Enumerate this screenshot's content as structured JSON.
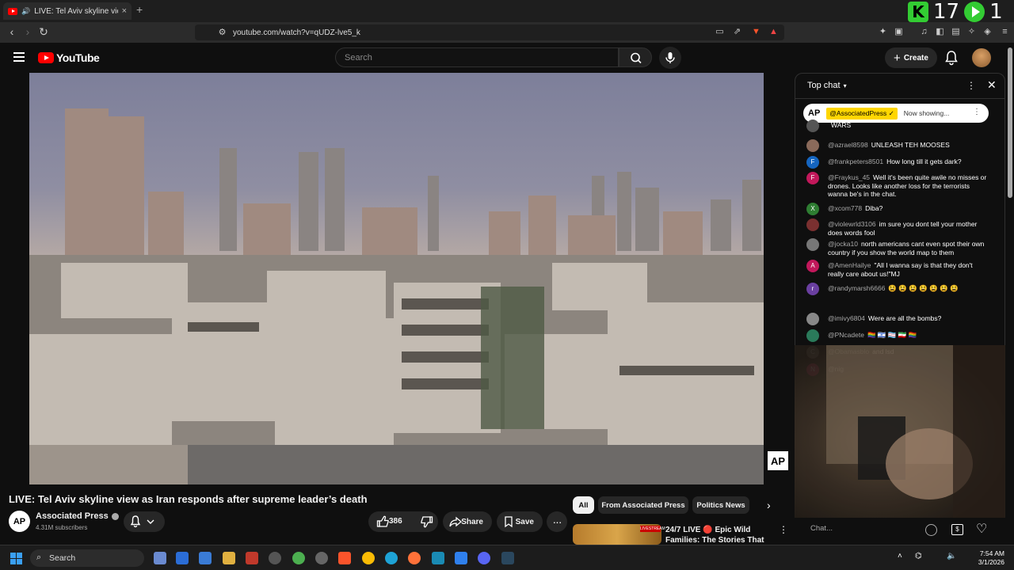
{
  "browser": {
    "tab_title": "LIVE: Tel Aviv skyline view as I",
    "tab_close": "×",
    "new_tab": "+",
    "url": "youtube.com/watch?v=qUDZ-lve5_k",
    "overlay_counter": "17",
    "overlay_counter_suffix": "1",
    "extension_badge": "1"
  },
  "youtube": {
    "logo_text": "YouTube",
    "search_placeholder": "Search",
    "create_label": "Create"
  },
  "video": {
    "title": "LIVE: Tel Aviv skyline view as Iran responds after supreme leader’s death",
    "watermark": "AP"
  },
  "channel": {
    "avatar_text": "AP",
    "name": "Associated Press",
    "subscribers": "4.31M subscribers"
  },
  "actions": {
    "like_count": "386",
    "share_label": "Share",
    "save_label": "Save",
    "more_label": "···"
  },
  "chips": [
    "All",
    "From Associated Press",
    "Politics News"
  ],
  "recommendation": {
    "title": "24/7 LIVE 🔴 Epic Wild Families: The Stories That ...",
    "badge": "LIVESTREAM"
  },
  "chat": {
    "header": "Top chat",
    "pinned": {
      "avatar": "AP",
      "user": "@AssociatedPress ✓",
      "status": "Now showing..."
    },
    "messages": [
      {
        "user": "",
        "text": "WARS",
        "avatar": "",
        "color": "#555"
      },
      {
        "user": "@azrael8598",
        "text": "UNLEASH TEH MOOSES",
        "avatar": "",
        "color": "#8a6a5a"
      },
      {
        "user": "@frankpeters8501",
        "text": "How long till it gets dark?",
        "avatar": "F",
        "color": "#1565c0"
      },
      {
        "user": "@Fraykus_45",
        "text": "Well it's been quite awile no misses or drones. Looks like another loss for the terrorists wanna be's in the chat.",
        "avatar": "F",
        "color": "#c2185b"
      },
      {
        "user": "@xcom778",
        "text": "Diba?",
        "avatar": "X",
        "color": "#2e7d32"
      },
      {
        "user": "@violewrld3106",
        "text": "im sure you dont tell your mother does words fool",
        "avatar": "",
        "color": "#7a3030"
      },
      {
        "user": "@jocka10",
        "text": "north americans cant even spot their own country if you show the world map to them",
        "avatar": "",
        "color": "#777"
      },
      {
        "user": "@AmenHailye",
        "text": "\"All I wanna say is that they don't really care about us!\"MJ",
        "avatar": "A",
        "color": "#c2185b"
      },
      {
        "user": "@randymarsh6666",
        "text": "😫 😫 😫 😫 😫 😫 😫",
        "avatar": "r",
        "color": "#6a3fa0"
      },
      {
        "user": "@imivy6804",
        "text": "Were are all the bombs?",
        "avatar": "",
        "color": "#888"
      },
      {
        "user": "@PNcadete",
        "text": "🏳️‍🌈 🇮🇱 🏳️‍⚧️ 🇮🇷 🏳️‍🌈",
        "avatar": "",
        "color": "#2a7a5a"
      },
      {
        "user": "@Obamasblo",
        "text": "and lsd",
        "avatar": "C",
        "color": "#7a6a6a"
      },
      {
        "user": "@nig",
        "text": "",
        "avatar": "N",
        "color": "#c2185b"
      }
    ],
    "input_placeholder": "Chat..."
  },
  "taskbar": {
    "search_label": "Search",
    "time": "7:54 AM",
    "date": "3/1/2026"
  }
}
